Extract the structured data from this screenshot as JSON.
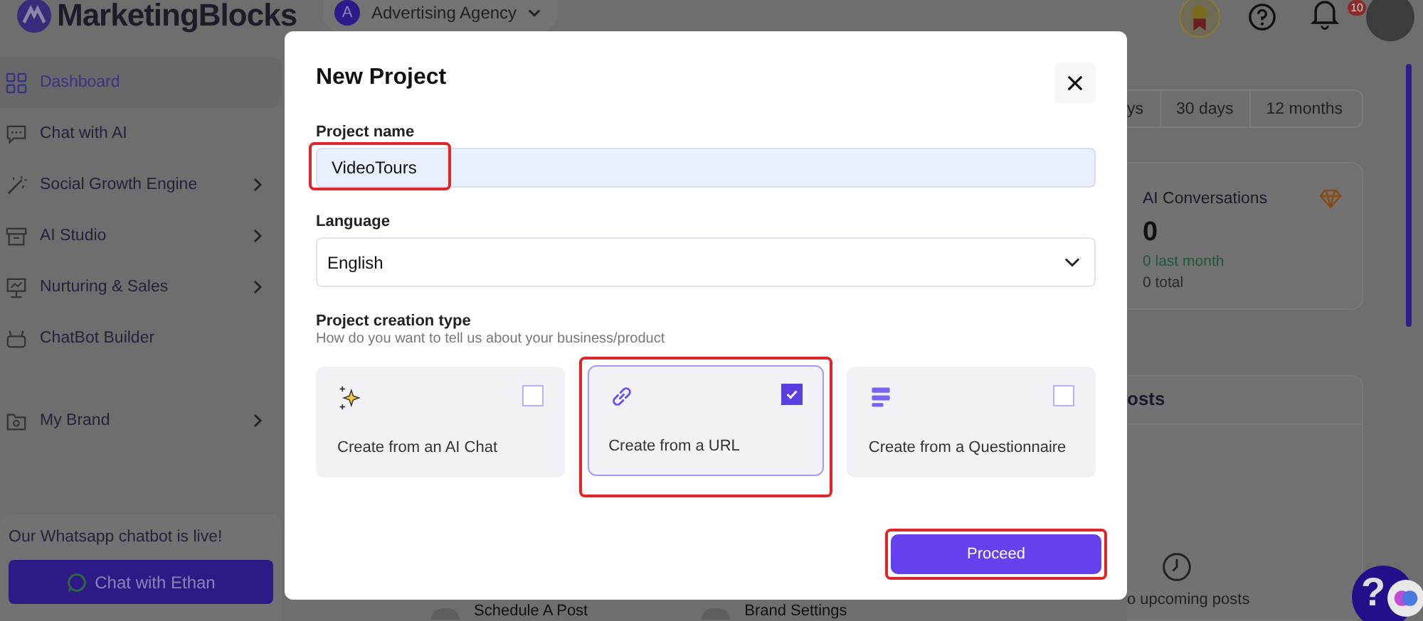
{
  "topbar": {
    "brand": "MarketingBlocks",
    "workspace": {
      "avatar_letter": "A",
      "name": "Advertising Agency"
    },
    "notification_badge": "10"
  },
  "sidebar": {
    "sections": [
      [
        {
          "label": "Dashboard",
          "kind": "grid",
          "selected": true,
          "expandable": false
        },
        {
          "label": "Chat with AI",
          "kind": "chat",
          "selected": false,
          "expandable": false
        },
        {
          "label": "Social Growth Engine",
          "kind": "wand",
          "selected": false,
          "expandable": true
        },
        {
          "label": "AI Studio",
          "kind": "archive",
          "selected": false,
          "expandable": true
        },
        {
          "label": "Nurturing & Sales",
          "kind": "board",
          "selected": false,
          "expandable": true
        },
        {
          "label": "ChatBot Builder",
          "kind": "bot",
          "selected": false,
          "expandable": false
        }
      ],
      [
        {
          "label": "My Brand",
          "kind": "folder",
          "selected": false,
          "expandable": true
        }
      ]
    ],
    "promo": {
      "text": "Our Whatsapp chatbot is live!",
      "button": "Chat with Ethan"
    }
  },
  "dashboard": {
    "period_tabs": [
      "ys",
      "30 days",
      "12 months"
    ],
    "stat_card": {
      "title": "AI Conversations",
      "value": "0",
      "change": "0 last month",
      "total": "0 total"
    },
    "posts_card": {
      "title": "osts",
      "empty_text": "o upcoming posts"
    },
    "quick_actions": [
      "Schedule A Post",
      "Brand Settings"
    ],
    "help_button": "?"
  },
  "modal": {
    "title": "New Project",
    "project_name": {
      "label": "Project name",
      "value": "VideoTours",
      "highlighted": true
    },
    "language": {
      "label": "Language",
      "value": "English"
    },
    "creation_type": {
      "label": "Project creation type",
      "hint": "How do you want to tell us about your business/product",
      "options": [
        {
          "label": "Create from an AI Chat",
          "kind": "sparkle",
          "selected": false,
          "highlighted": false
        },
        {
          "label": "Create from a URL",
          "kind": "link",
          "selected": true,
          "highlighted": true
        },
        {
          "label": "Create from a Questionnaire",
          "kind": "list",
          "selected": false,
          "highlighted": false
        }
      ]
    },
    "proceed_button": {
      "label": "Proceed",
      "highlighted": true
    }
  }
}
